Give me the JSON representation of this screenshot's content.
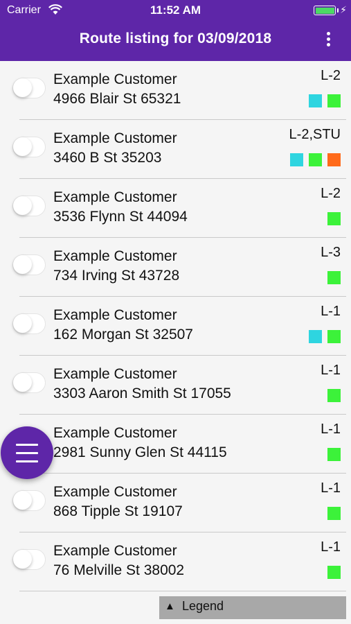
{
  "status_bar": {
    "carrier": "Carrier",
    "time": "11:52 AM"
  },
  "header": {
    "title": "Route listing for 03/09/2018"
  },
  "colors": {
    "header": "#5e26a8",
    "cyan": "#2ed5e0",
    "green": "#3cf23a",
    "orange": "#ff6a1a"
  },
  "rows": [
    {
      "name": "Example Customer",
      "address": "4966 Blair St 65321",
      "code": "L-2",
      "badges": [
        "cyan",
        "green"
      ]
    },
    {
      "name": "Example Customer",
      "address": "3460 B St 35203",
      "code": "L-2,STU",
      "badges": [
        "cyan",
        "green",
        "orange"
      ]
    },
    {
      "name": "Example Customer",
      "address": "3536 Flynn St 44094",
      "code": "L-2",
      "badges": [
        "green"
      ]
    },
    {
      "name": "Example Customer",
      "address": "734 Irving St 43728",
      "code": "L-3",
      "badges": [
        "green"
      ]
    },
    {
      "name": "Example Customer",
      "address": "162 Morgan St 32507",
      "code": "L-1",
      "badges": [
        "cyan",
        "green"
      ]
    },
    {
      "name": "Example Customer",
      "address": "3303 Aaron Smith St 17055",
      "code": "L-1",
      "badges": [
        "green"
      ]
    },
    {
      "name": "Example Customer",
      "address": "2981 Sunny Glen St 44115",
      "code": "L-1",
      "badges": [
        "green"
      ]
    },
    {
      "name": "Example Customer",
      "address": "868 Tipple St 19107",
      "code": "L-1",
      "badges": [
        "green"
      ]
    },
    {
      "name": "Example Customer",
      "address": "76 Melville St 38002",
      "code": "L-1",
      "badges": [
        "green"
      ]
    }
  ],
  "legend": {
    "label": "Legend",
    "arrow": "▲"
  }
}
